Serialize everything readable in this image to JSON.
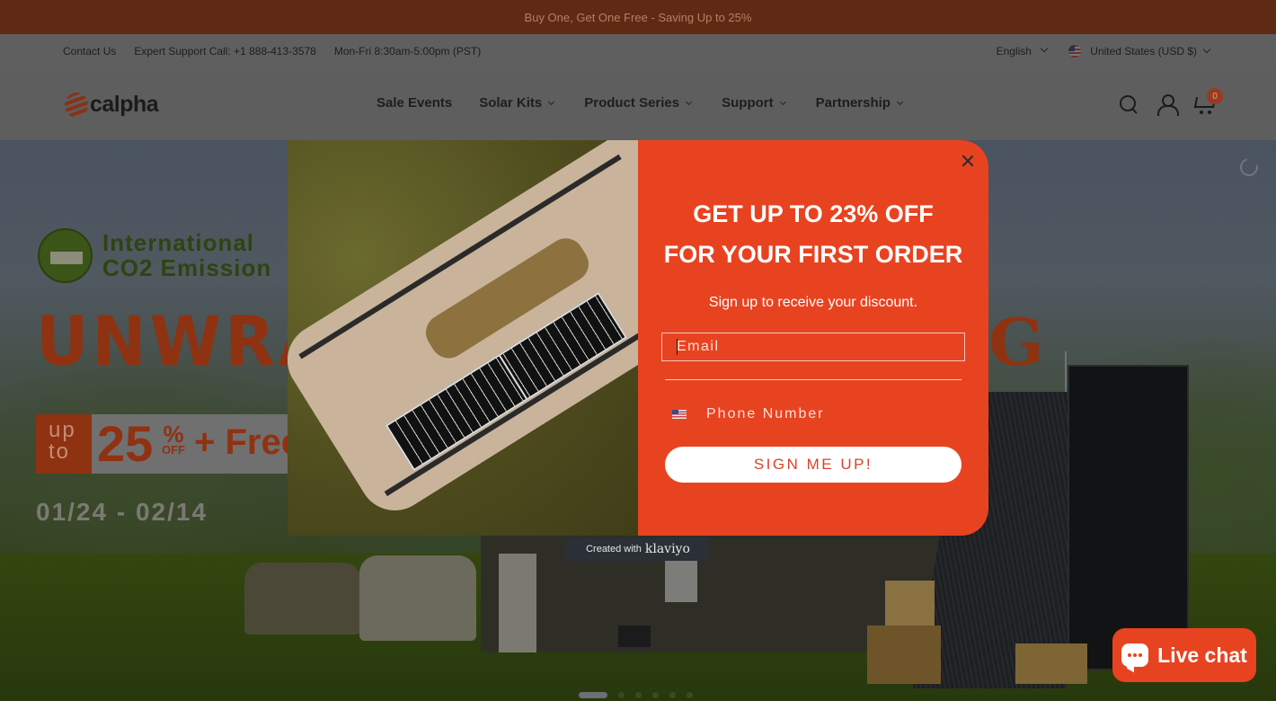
{
  "announcement": {
    "text": "Buy One, Get One Free - Saving Up to 25%"
  },
  "utility_bar": {
    "links": [
      "Contact Us",
      "Expert Support Call: +1 888-413-3578",
      "Mon-Fri 8:30am-5:00pm (PST)"
    ],
    "language": "English",
    "country_currency": "United States (USD $)"
  },
  "header": {
    "logo_text": "calpha",
    "nav": [
      {
        "label": "Sale Events",
        "has_dropdown": false
      },
      {
        "label": "Solar Kits",
        "has_dropdown": true
      },
      {
        "label": "Product Series",
        "has_dropdown": true
      },
      {
        "label": "Support",
        "has_dropdown": true
      },
      {
        "label": "Partnership",
        "has_dropdown": true
      }
    ],
    "icons": [
      "search-icon",
      "account-icon",
      "cart-icon"
    ],
    "cart_count": "0"
  },
  "hero": {
    "badge_line1": "International",
    "badge_line2": "CO2 Emission",
    "headline_left": "UNWRA",
    "headline_right": "G",
    "promo_upto_1": "up",
    "promo_upto_2": "to",
    "promo_number": "25",
    "promo_pct": "%",
    "promo_off": "OFF",
    "promo_plus": "+ Free",
    "dates": "01/24 - 02/14",
    "slide_count": 6,
    "active_slide": 1
  },
  "popup": {
    "headline_line1": "GET UP TO 23% OFF",
    "headline_line2": "FOR YOUR FIRST ORDER",
    "subline": "Sign up to receive your discount.",
    "email_placeholder": "Email",
    "email_value": "",
    "phone_placeholder": "Phone Number",
    "phone_value": "",
    "phone_country": "US",
    "submit_label": "SIGN ME UP!",
    "created_with": "Created with",
    "brand": "klaviyo",
    "accent_color": "#e84321"
  },
  "live_chat": {
    "label": "Live chat"
  }
}
